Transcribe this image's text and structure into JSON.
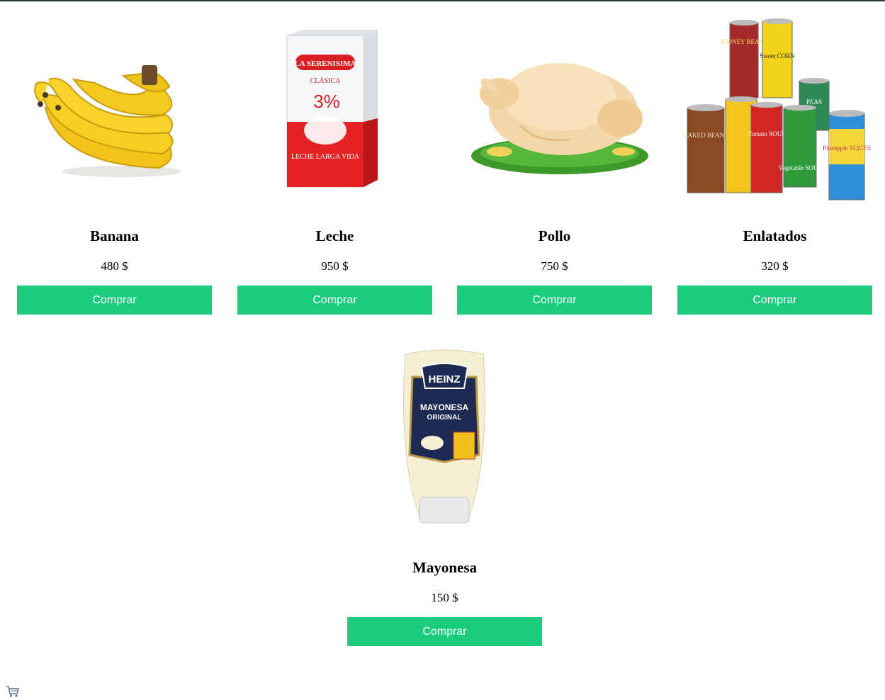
{
  "products": [
    {
      "name": "Banana",
      "price": "480 $",
      "button": "Comprar",
      "image": "banana-bunch"
    },
    {
      "name": "Leche",
      "price": "950 $",
      "button": "Comprar",
      "image": "milk-carton",
      "image_text": {
        "brand": "LA SERENISIMA",
        "variant": "CLÁSICA",
        "pct": "3%",
        "desc": "LECHE LARGA VIDA"
      }
    },
    {
      "name": "Pollo",
      "price": "750 $",
      "button": "Comprar",
      "image": "whole-chicken"
    },
    {
      "name": "Enlatados",
      "price": "320 $",
      "button": "Comprar",
      "image": "canned-goods",
      "image_text": {
        "can1": "KIDNEY BEANS",
        "can2": "Sweet CORN",
        "can3": "BAKED BEANS",
        "can4": "Tomato SOUP",
        "can5": "Vegetable SOUP",
        "can6": "PEAS",
        "can7": "Pineapple SLICES"
      }
    },
    {
      "name": "Mayonesa",
      "price": "150 $",
      "button": "Comprar",
      "image": "mayonnaise-bottle",
      "image_text": {
        "brand": "HEINZ",
        "product": "MAYONESA",
        "sub": "ORIGINAL"
      }
    }
  ],
  "colors": {
    "button": "#1ccc7d",
    "button_text": "#ffffff",
    "top_border": "#2d3a3a"
  },
  "footer": {
    "icon": "cart-icon"
  }
}
